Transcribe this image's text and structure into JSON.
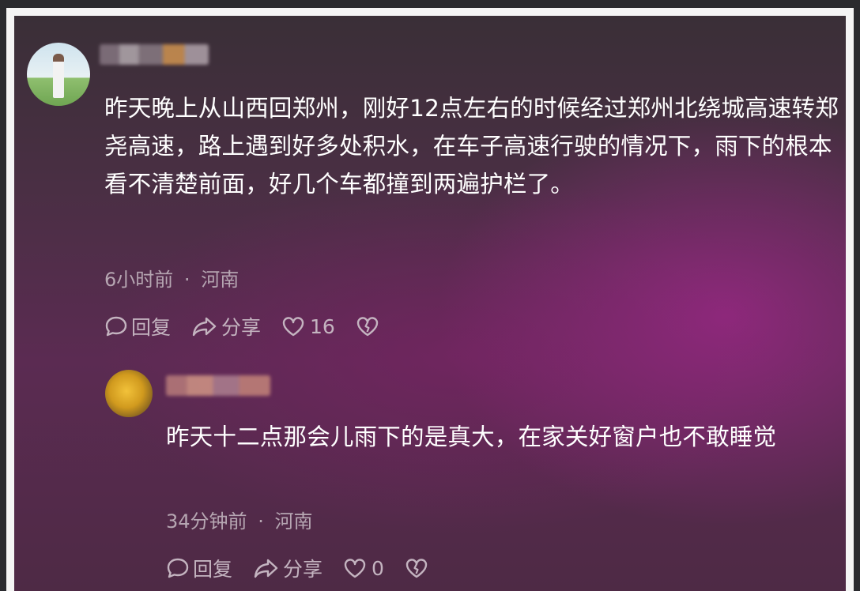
{
  "comments": [
    {
      "text": "昨天晚上从山西回郑州，刚好12点左右的时候经过郑州北绕城高速转郑尧高速，路上遇到好多处积水，在车子高速行驶的情况下，雨下的根本看不清楚前面，好几个车都撞到两遍护栏了。",
      "time": "6小时前",
      "separator": "·",
      "location": "河南",
      "reply_label": "回复",
      "share_label": "分享",
      "like_count": "16"
    },
    {
      "text": "昨天十二点那会儿雨下的是真大，在家关好窗户也不敢睡觉",
      "time": "34分钟前",
      "separator": "·",
      "location": "河南",
      "reply_label": "回复",
      "share_label": "分享",
      "like_count": "0"
    }
  ],
  "icons": {
    "reply": "comment-bubble-icon",
    "share": "share-arrow-icon",
    "like": "heart-icon",
    "dislike": "broken-heart-icon"
  },
  "colors": {
    "text": "#ffffff",
    "meta": "#b6a6b2",
    "actions": "#c4b4c0"
  }
}
